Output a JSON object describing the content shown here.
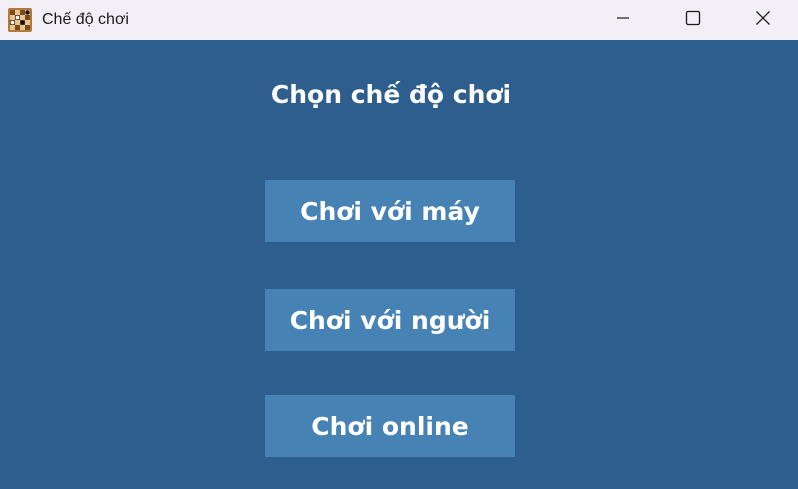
{
  "window": {
    "title": "Chế độ chơi",
    "controls": [
      "minimize-icon",
      "maximize-icon",
      "close-icon"
    ]
  },
  "main": {
    "heading": "Chọn chế độ chơi",
    "buttons": [
      {
        "label": "Chơi với máy"
      },
      {
        "label": "Chơi với người"
      },
      {
        "label": "Chơi online"
      }
    ]
  },
  "colors": {
    "background": "#2e5e8d",
    "button": "#4682b4",
    "titlebar": "#f3eff7",
    "text": "#ffffff"
  }
}
